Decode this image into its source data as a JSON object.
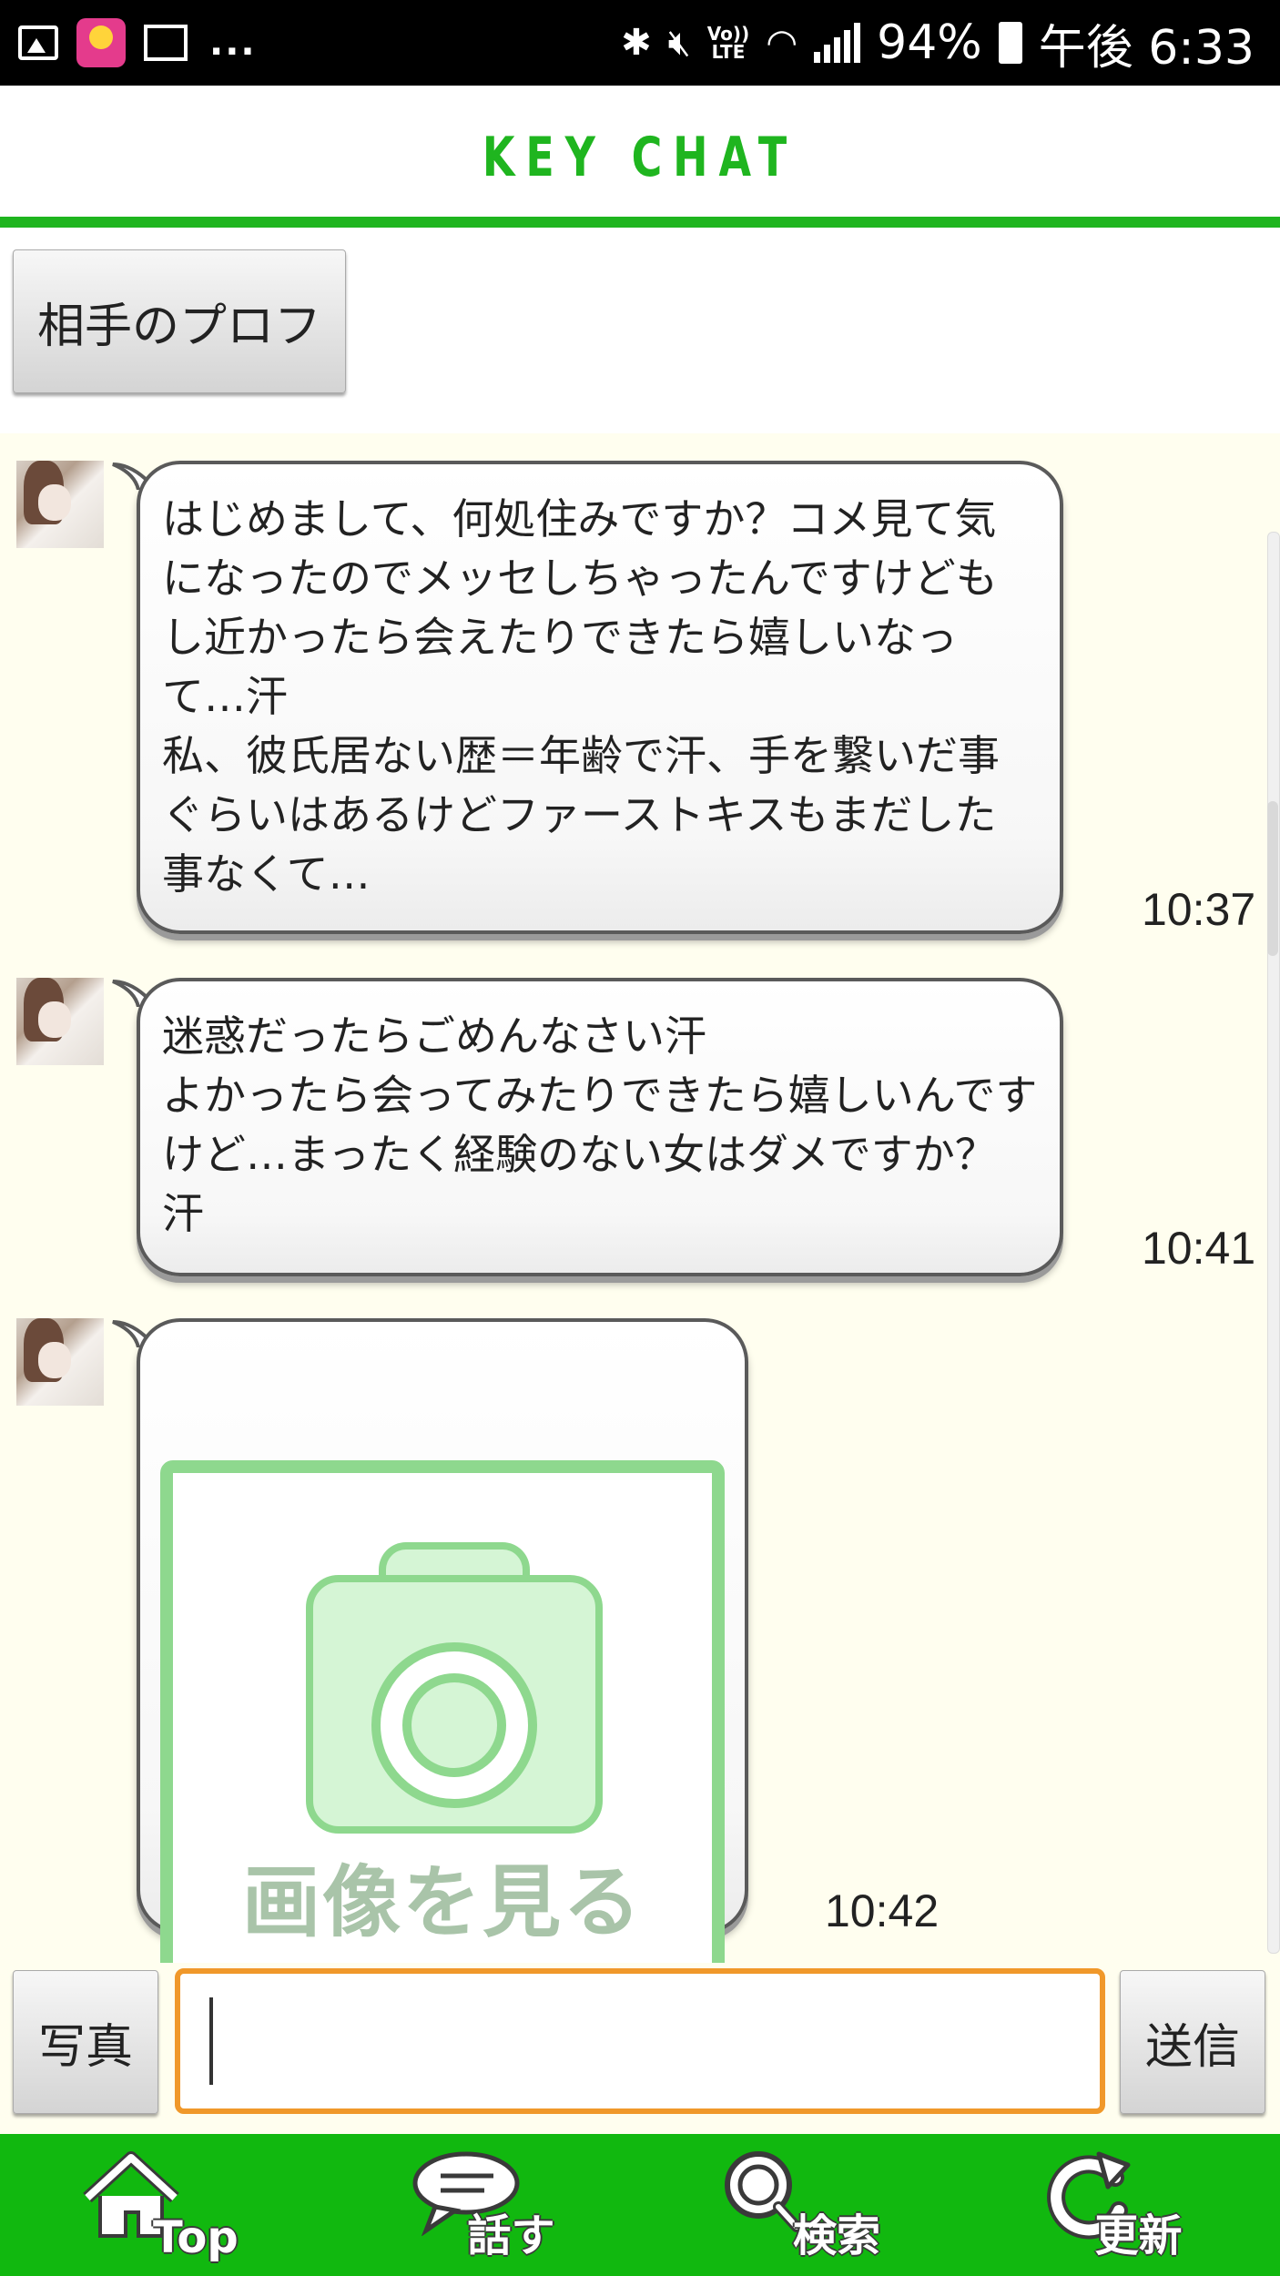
{
  "status_bar": {
    "battery": "94%",
    "time": "午後 6:33",
    "overflow": "...",
    "network": "Vo))\nLTE"
  },
  "header": {
    "title": "KEY CHAT"
  },
  "profile_button": {
    "label": "相手のプロフ"
  },
  "messages": [
    {
      "text": "はじめまして、何処住みですか？コメ見て気になったのでメッセしちゃったんですけどもし近かったら会えたりできたら嬉しいなって…汗\n私、彼氏居ない歴＝年齢で汗、手を繋いだ事ぐらいはあるけどファーストキスもまだした事なくて…",
      "time": "10:37"
    },
    {
      "text": "迷惑だったらごめんなさい汗\nよかったら会ってみたりできたら嬉しいんですけど…まったく経験のない女はダメですか？汗",
      "time": "10:41"
    },
    {
      "image_caption": "画像を見る",
      "time": "10:42"
    }
  ],
  "composer": {
    "photo_label": "写真",
    "send_label": "送信",
    "input_value": "",
    "input_placeholder": ""
  },
  "bottom_nav": [
    {
      "label": "Top",
      "icon": "home-icon"
    },
    {
      "label": "話す",
      "icon": "speech-bubble-icon"
    },
    {
      "label": "検索",
      "icon": "search-icon"
    },
    {
      "label": "更新",
      "icon": "refresh-icon"
    }
  ],
  "colors": {
    "brand_green": "#11b80f",
    "header_green": "#1fb51f",
    "chat_bg": "#fffeef",
    "input_border": "#f0982a",
    "image_frame_green": "#8ed88e"
  }
}
